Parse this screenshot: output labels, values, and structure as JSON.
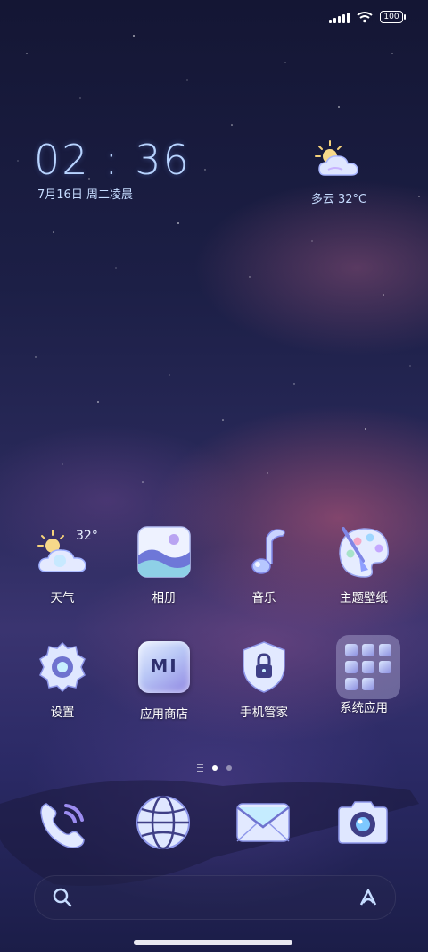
{
  "status_bar": {
    "battery": "100"
  },
  "clock": {
    "time": "02 : 36",
    "date": "7月16日 周二凌晨"
  },
  "weather_widget": {
    "text": "多云  32°C",
    "icon": "partly-cloudy-icon"
  },
  "apps_row1": [
    {
      "label": "天气",
      "icon": "weather-icon",
      "badge": "32°"
    },
    {
      "label": "相册",
      "icon": "gallery-icon"
    },
    {
      "label": "音乐",
      "icon": "music-note-icon"
    },
    {
      "label": "主题壁纸",
      "icon": "palette-icon"
    }
  ],
  "apps_row2": [
    {
      "label": "设置",
      "icon": "gear-icon"
    },
    {
      "label": "应用商店",
      "icon": "app-store-icon",
      "logo": "mi"
    },
    {
      "label": "手机管家",
      "icon": "shield-lock-icon"
    },
    {
      "label": "系统应用",
      "icon": "folder-icon"
    }
  ],
  "page_indicator": {
    "pages": 2,
    "current": 1
  },
  "dock": [
    {
      "icon": "phone-icon"
    },
    {
      "icon": "browser-globe-icon"
    },
    {
      "icon": "mail-icon"
    },
    {
      "icon": "camera-icon"
    }
  ],
  "colors": {
    "accent": "#b8d4ff",
    "icon_light": "#e8f0ff",
    "icon_purple": "#8f86e2"
  }
}
